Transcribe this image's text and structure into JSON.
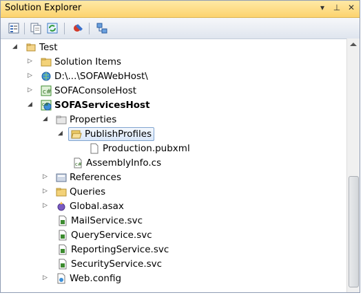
{
  "window": {
    "title": "Solution Explorer",
    "pin_icon": "dropdown-icon",
    "autohide_icon": "pin-icon",
    "close_icon": "close-icon"
  },
  "toolbar": {
    "items": [
      "properties-icon",
      "show-all-files-icon",
      "refresh-icon",
      "view-code-icon",
      "class-diagram-icon"
    ]
  },
  "tree": {
    "solution": "Test",
    "items": [
      {
        "label": "Solution Items",
        "icon": "folder-icon",
        "bold": false
      },
      {
        "label": "D:\\...\\SOFAWebHost\\",
        "icon": "website-icon",
        "bold": false
      },
      {
        "label": "SOFAConsoleHost",
        "icon": "csharp-project-icon",
        "bold": false
      },
      {
        "label": "SOFAServicesHost",
        "icon": "web-project-icon",
        "bold": true
      },
      {
        "label": "Properties",
        "icon": "properties-folder-icon",
        "bold": false
      },
      {
        "label": "PublishProfiles",
        "icon": "open-folder-icon",
        "bold": false
      },
      {
        "label": "Production.pubxml",
        "icon": "file-icon",
        "bold": false
      },
      {
        "label": "AssemblyInfo.cs",
        "icon": "cs-file-icon",
        "bold": false
      },
      {
        "label": "References",
        "icon": "references-icon",
        "bold": false
      },
      {
        "label": "Queries",
        "icon": "folder-icon",
        "bold": false
      },
      {
        "label": "Global.asax",
        "icon": "global-asax-icon",
        "bold": false
      },
      {
        "label": "MailService.svc",
        "icon": "svc-file-icon",
        "bold": false
      },
      {
        "label": "QueryService.svc",
        "icon": "svc-file-icon",
        "bold": false
      },
      {
        "label": "ReportingService.svc",
        "icon": "svc-file-icon",
        "bold": false
      },
      {
        "label": "SecurityService.svc",
        "icon": "svc-file-icon",
        "bold": false
      },
      {
        "label": "Web.config",
        "icon": "config-file-icon",
        "bold": false
      }
    ]
  },
  "colors": {
    "titlebar": "#fcd36e",
    "selection_border": "#7da2ce",
    "folder": "#e8c15a"
  }
}
